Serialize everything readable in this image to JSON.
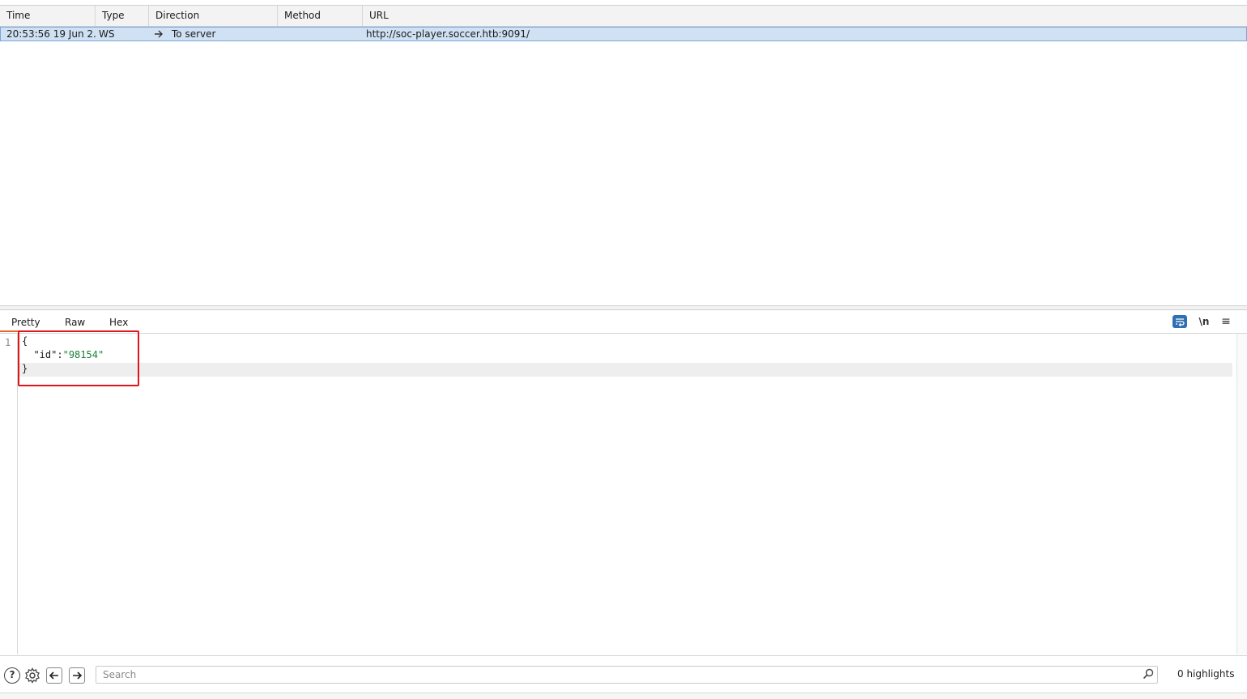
{
  "table": {
    "columns": [
      "Time",
      "Type",
      "Direction",
      "Method",
      "URL"
    ],
    "rows": [
      {
        "time": "20:53:56 19 Jun 2...",
        "type": "WS",
        "direction_icon": "arrow-right-icon",
        "direction": "To server",
        "method": "",
        "url": "http://soc-player.soccer.htb:9091/"
      }
    ]
  },
  "viewer": {
    "tabs": [
      "Pretty",
      "Raw",
      "Hex"
    ],
    "active_tab": "Pretty",
    "toolbar_icons": [
      "wrap-lines-icon",
      "newline-toggle-icon",
      "menu-icon"
    ],
    "newline_label": "\\n",
    "menu_glyph": "≡",
    "line_number": "1",
    "code": {
      "open_brace": "{",
      "key": "\"id\"",
      "colon": ":",
      "value": "\"98154\"",
      "close_brace": "}"
    },
    "highlight_box_color": "#e0141b"
  },
  "bottom_bar": {
    "icons": [
      "help-icon",
      "gear-icon",
      "back-arrow-icon",
      "forward-arrow-icon",
      "search-icon"
    ],
    "search_placeholder": "Search",
    "highlights": "0 highlights"
  },
  "colors": {
    "selected_row": "#cfe1f3",
    "active_tab_underline": "#e8622c",
    "string_value": "#1a7f37",
    "wrap_button": "#2f6fb2"
  }
}
